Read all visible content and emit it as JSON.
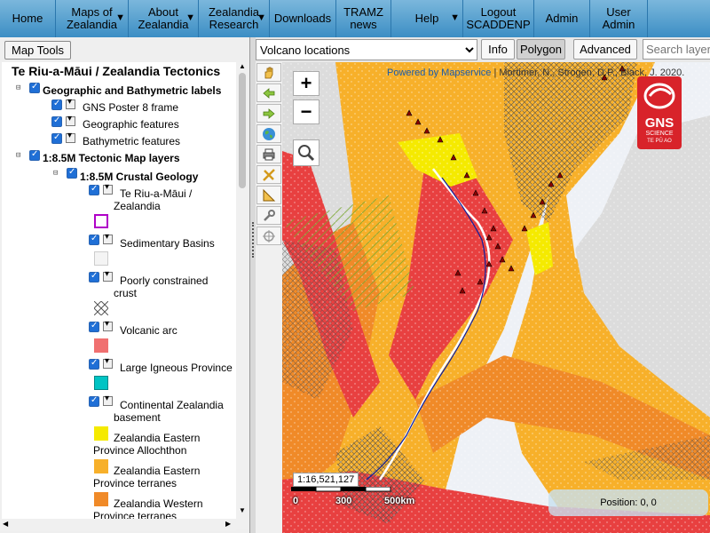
{
  "nav": {
    "home": "Home",
    "maps": [
      "Maps of",
      "Zealandia"
    ],
    "about": [
      "About",
      "Zealandia"
    ],
    "research": [
      "Zealandia",
      "Research"
    ],
    "downloads": "Downloads",
    "tramz": [
      "TRAMZ",
      "news"
    ],
    "help": "Help",
    "logout": [
      "Logout",
      "SCADDENP"
    ],
    "admin": "Admin",
    "user_admin": [
      "User",
      "Admin"
    ]
  },
  "left": {
    "map_tools": "Map Tools",
    "title": "Te Riu-a-Māui / Zealandia Tectonics",
    "group1": "Geographic and Bathymetric labels",
    "g1_items": [
      "GNS Poster 8 frame",
      "Geographic features",
      "Bathymetric features"
    ],
    "group2": "1:8.5M Tectonic Map layers",
    "subgroup": "1:8.5M Crustal Geology",
    "layers": [
      {
        "label": [
          "Te Riu-a-Māui /",
          "Zealandia"
        ],
        "swatch": "#b000c8"
      },
      {
        "label": [
          "Sedimentary Basins"
        ],
        "swatch": "#f4f4f4"
      },
      {
        "label": [
          "Poorly constrained",
          "crust"
        ],
        "swatch": "hatch"
      },
      {
        "label": [
          "Volcanic arc"
        ],
        "swatch": "#f07070"
      },
      {
        "label": [
          "Large Igneous Province"
        ],
        "swatch": "#00c4c4"
      },
      {
        "label": [
          "Continental Zealandia",
          "basement"
        ],
        "swatch": ""
      }
    ],
    "legend": [
      {
        "label": [
          "Zealandia Eastern",
          "Province Allochthon"
        ],
        "color": "#f5ea00"
      },
      {
        "label": [
          "Zealandia Eastern",
          "Province terranes"
        ],
        "color": "#f7b02a"
      },
      {
        "label": [
          "Zealandia Western",
          "Province terranes"
        ],
        "color": "#f08a28"
      }
    ]
  },
  "toolbar": {
    "layer_select": "Volcano locations",
    "info": "Info",
    "polygon": "Polygon",
    "advanced": "Advanced",
    "search_placeholder": "Search layers"
  },
  "map": {
    "attribution_link1": "Powered by",
    "attribution_link2": "Mapservice",
    "attribution": " | Mortimer, N., Strogen, D.P., Black, J. 2020.",
    "zoom_in": "+",
    "zoom_out": "−",
    "scale_ratio": "1:16,521,127",
    "scale_labels": [
      "0",
      "300",
      "500km"
    ],
    "position": "Position: 0, 0",
    "logo_text": [
      "GNS",
      "SCIENCE",
      "TE PŪ AO"
    ]
  },
  "colors": {
    "nav_top": "#7bb7dc",
    "nav_bottom": "#3c8ec4",
    "eastern_allochthon": "#f5ea00",
    "eastern_terranes": "#f7b02a",
    "western_terranes": "#f08a28",
    "volcanic_arc": "#e84040",
    "gns_red": "#d8232a"
  }
}
